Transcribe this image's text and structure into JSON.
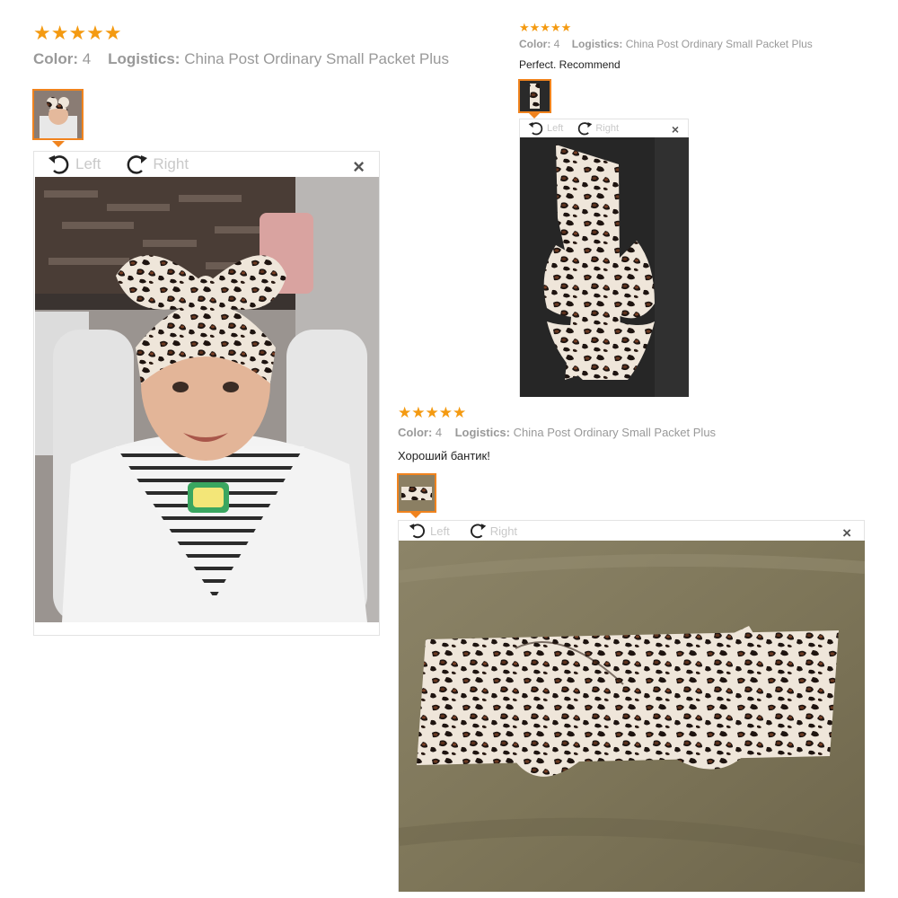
{
  "controls": {
    "rotate_left": "Left",
    "rotate_right": "Right",
    "close": "×"
  },
  "reviews": [
    {
      "rating": "★★★★★",
      "color_label": "Color:",
      "color_value": "4",
      "logistics_label": "Logistics:",
      "logistics_value": "China Post Ordinary Small Packet Plus",
      "comment": ""
    },
    {
      "rating": "★★★★★",
      "color_label": "Color:",
      "color_value": "4",
      "logistics_label": "Logistics:",
      "logistics_value": "China Post Ordinary Small Packet Plus",
      "comment": "Perfect. Recommend"
    },
    {
      "rating": "★★★★★",
      "color_label": "Color:",
      "color_value": "4",
      "logistics_label": "Logistics:",
      "logistics_value": "China Post Ordinary Small Packet Plus",
      "comment": "Хороший бантик!"
    }
  ],
  "colors": {
    "star": "#f49a11",
    "thumb_border": "#f0831e",
    "control_text": "#c9c9c9"
  }
}
